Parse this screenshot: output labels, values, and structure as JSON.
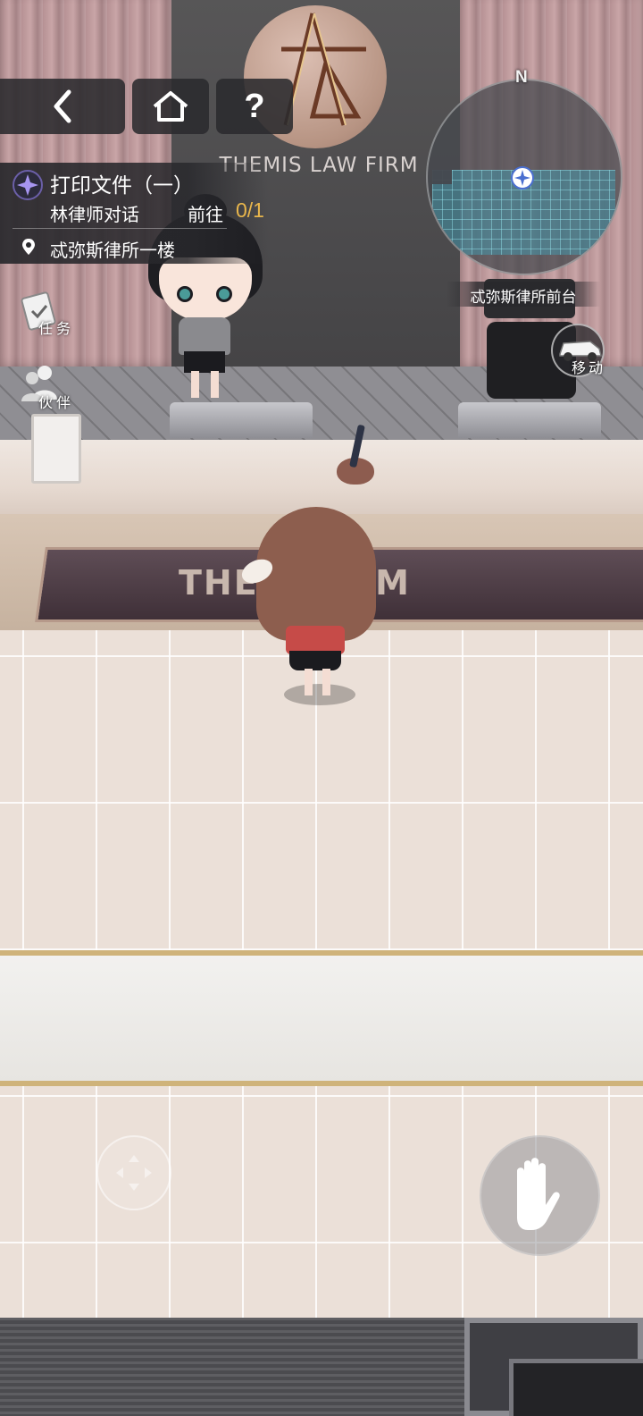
{
  "scene": {
    "firm_sign": "THEMIS  LAW FIRM",
    "counter_plaque": "THEM        FIRM"
  },
  "top_bar": {
    "back_icon": "chevron-left-icon",
    "home_icon": "home-icon",
    "help_label": "?"
  },
  "quest": {
    "icon": "sparkle-icon",
    "title": "打印文件（一）",
    "objective": "林律师对话",
    "go_label": "前往",
    "progress": "0/1",
    "location_icon": "map-pin-icon",
    "location": "忒弥斯律所一楼"
  },
  "side_menu": {
    "tasks_label": "任务",
    "partners_label": "伙伴"
  },
  "minimap": {
    "north_label": "N",
    "area_name": "忒弥斯律所前台",
    "move_label": "移动"
  },
  "controls": {
    "joystick_icon": "joystick-icon",
    "interact_icon": "hand-icon"
  },
  "colors": {
    "progress": "#e8b64c",
    "hud_bg": "#2a2a2e",
    "trim_gold": "#cfb37a"
  }
}
